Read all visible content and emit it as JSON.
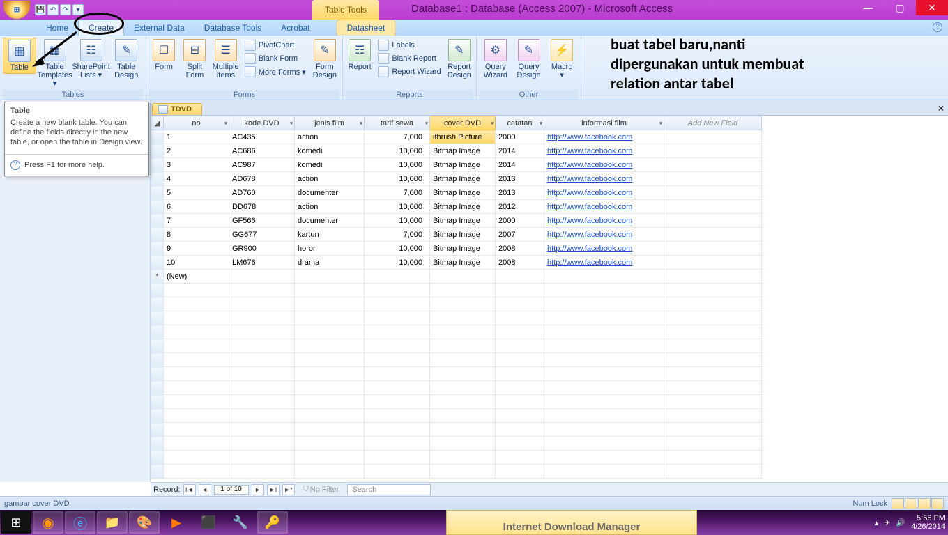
{
  "window": {
    "context_tab": "Table Tools",
    "title": "Database1 : Database (Access 2007) - Microsoft Access"
  },
  "tabs": {
    "home": "Home",
    "create": "Create",
    "external": "External Data",
    "dbtools": "Database Tools",
    "acrobat": "Acrobat",
    "datasheet": "Datasheet"
  },
  "ribbon": {
    "tables": {
      "label": "Tables",
      "table": "Table",
      "templates": "Table\nTemplates ▾",
      "sharepoint": "SharePoint\nLists ▾",
      "design": "Table\nDesign"
    },
    "forms": {
      "label": "Forms",
      "form": "Form",
      "split": "Split\nForm",
      "multi": "Multiple\nItems",
      "pivot": "PivotChart",
      "blank": "Blank Form",
      "more": "More Forms ▾",
      "fdesign": "Form\nDesign"
    },
    "reports": {
      "label": "Reports",
      "report": "Report",
      "labels": "Labels",
      "blank": "Blank Report",
      "wizard": "Report Wizard",
      "rdesign": "Report\nDesign"
    },
    "other": {
      "label": "Other",
      "qwiz": "Query\nWizard",
      "qdes": "Query\nDesign",
      "macro": "Macro\n▾"
    }
  },
  "annotation": "buat tabel baru,nanti\ndipergunakan untuk membuat\nrelation antar tabel",
  "tooltip": {
    "title": "Table",
    "body": "Create a new blank table. You can define the fields directly in the new table, or open the table in Design view.",
    "foot": "Press F1 for more help."
  },
  "doctab": "TDVD",
  "columns": [
    "no",
    "kode DVD",
    "jenis film",
    "tarif sewa",
    "cover DVD",
    "catatan",
    "informasi film",
    "Add New Field"
  ],
  "rows": [
    {
      "no": "1",
      "kode": "AC435",
      "jenis": "action",
      "tarif": "7,000",
      "cover": "itbrush Picture",
      "catatan": "2000",
      "info": "http://www.facebook.com"
    },
    {
      "no": "2",
      "kode": "AC686",
      "jenis": "komedi",
      "tarif": "10,000",
      "cover": "Bitmap Image",
      "catatan": "2014",
      "info": "http://www.facebook.com"
    },
    {
      "no": "3",
      "kode": "AC987",
      "jenis": "komedi",
      "tarif": "10,000",
      "cover": "Bitmap Image",
      "catatan": "2014",
      "info": "http://www.facebook.com"
    },
    {
      "no": "4",
      "kode": "AD678",
      "jenis": "action",
      "tarif": "10,000",
      "cover": "Bitmap Image",
      "catatan": "2013",
      "info": "http://www.facebook.com"
    },
    {
      "no": "5",
      "kode": "AD760",
      "jenis": "documenter",
      "tarif": "7,000",
      "cover": "Bitmap Image",
      "catatan": "2013",
      "info": "http://www.facebook.com"
    },
    {
      "no": "6",
      "kode": "DD678",
      "jenis": "action",
      "tarif": "10,000",
      "cover": "Bitmap Image",
      "catatan": "2012",
      "info": "http://www.facebook.com"
    },
    {
      "no": "7",
      "kode": "GF566",
      "jenis": "documenter",
      "tarif": "10,000",
      "cover": "Bitmap Image",
      "catatan": "2000",
      "info": "http://www.facebook.com"
    },
    {
      "no": "8",
      "kode": "GG677",
      "jenis": "kartun",
      "tarif": "7,000",
      "cover": "Bitmap Image",
      "catatan": "2007",
      "info": "http://www.facebook.com"
    },
    {
      "no": "9",
      "kode": "GR900",
      "jenis": "horor",
      "tarif": "10,000",
      "cover": "Bitmap Image",
      "catatan": "2008",
      "info": "http://www.facebook.com"
    },
    {
      "no": "10",
      "kode": "LM676",
      "jenis": "drama",
      "tarif": "10,000",
      "cover": "Bitmap Image",
      "catatan": "2008",
      "info": "http://www.facebook.com"
    }
  ],
  "newrow": "(New)",
  "recnav": {
    "label": "Record:",
    "pos": "1 of 10",
    "nofilter": "No Filter",
    "search": "Search"
  },
  "status": {
    "left": "gambar cover DVD",
    "numlock": "Num Lock"
  },
  "idm": "Internet Download Manager",
  "tray": {
    "time": "5:56 PM",
    "date": "4/26/2014"
  }
}
